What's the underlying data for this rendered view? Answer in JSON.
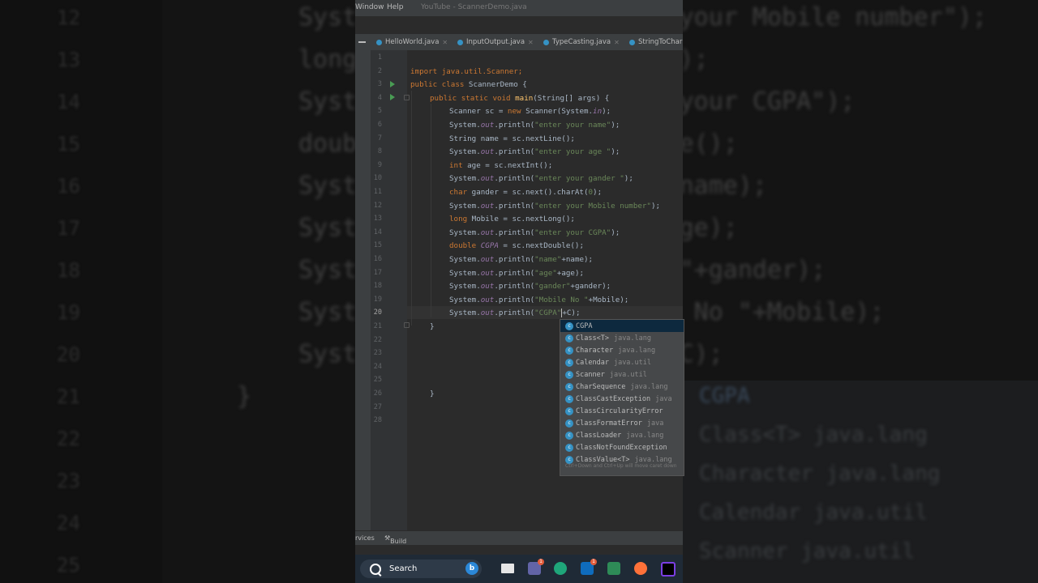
{
  "menu": {
    "window": "Window",
    "help": "Help",
    "title": "YouTube - ScannerDemo.java"
  },
  "tabs": [
    {
      "label": "HelloWorld.java"
    },
    {
      "label": "InputOutput.java"
    },
    {
      "label": "TypeCasting.java"
    },
    {
      "label": "StringToChar"
    }
  ],
  "line_numbers": [
    "1",
    "2",
    "3",
    "4",
    "5",
    "6",
    "7",
    "8",
    "9",
    "10",
    "11",
    "12",
    "13",
    "14",
    "15",
    "16",
    "17",
    "18",
    "19",
    "20",
    "21",
    "22",
    "23",
    "24",
    "25",
    "26",
    "27",
    "28"
  ],
  "active_line": "20",
  "code": {
    "l2": [
      "import java.util.Scanner;"
    ],
    "l3": [
      "public class",
      " ScannerDemo {"
    ],
    "l4": [
      "public static void",
      " ",
      "main",
      "(String[] args) {"
    ],
    "l5": [
      "Scanner sc = ",
      "new",
      " Scanner(System.",
      "in",
      ");"
    ],
    "l6": [
      "System.",
      "out",
      ".println(",
      "\"enter your name\"",
      ");"
    ],
    "l7": [
      "String name = sc.nextLine();"
    ],
    "l8": [
      "System.",
      "out",
      ".println(",
      "\"enter your age \"",
      ");"
    ],
    "l9": [
      "int",
      " age = sc.nextInt();"
    ],
    "l10": [
      "System.",
      "out",
      ".println(",
      "\"enter your gander \"",
      ");"
    ],
    "l11": [
      "char",
      " gander = sc.next().charAt(",
      "0",
      ");"
    ],
    "l12": [
      "System.",
      "out",
      ".println(",
      "\"enter your Mobile number\"",
      ");"
    ],
    "l13": [
      "long",
      " Mobile = sc.nextLong();"
    ],
    "l14": [
      "System.",
      "out",
      ".println(",
      "\"enter your CGPA\"",
      ");"
    ],
    "l15": [
      "double",
      " ",
      "CGPA",
      " = sc.nextDouble();"
    ],
    "l16": [
      "System.",
      "out",
      ".println(",
      "\"name\"",
      "+name);"
    ],
    "l17": [
      "System.",
      "out",
      ".println(",
      "\"age\"",
      "+age);"
    ],
    "l18": [
      "System.",
      "out",
      ".println(",
      "\"gander\"",
      "+gander);"
    ],
    "l19": [
      "System.",
      "out",
      ".println(",
      "\"Mobile No \"",
      "+Mobile);"
    ],
    "l20": [
      "System.",
      "out",
      ".println(",
      "\"CGPA\"",
      "+C",
      ");"
    ],
    "l21": [
      "}"
    ],
    "l26": [
      "}"
    ]
  },
  "autocomplete": {
    "items": [
      {
        "name": "CGPA",
        "pkg": ""
      },
      {
        "name": "Class<T>",
        "pkg": "java.lang"
      },
      {
        "name": "Character",
        "pkg": "java.lang"
      },
      {
        "name": "Calendar",
        "pkg": "java.util"
      },
      {
        "name": "Scanner",
        "pkg": "java.util"
      },
      {
        "name": "CharSequence",
        "pkg": "java.lang"
      },
      {
        "name": "ClassCastException",
        "pkg": "java"
      },
      {
        "name": "ClassCircularityError",
        "pkg": ""
      },
      {
        "name": "ClassFormatError",
        "pkg": "java"
      },
      {
        "name": "ClassLoader",
        "pkg": "java.lang"
      },
      {
        "name": "ClassNotFoundException",
        "pkg": ""
      },
      {
        "name": "ClassValue<T>",
        "pkg": "java.lang"
      }
    ],
    "hint": "Ctrl+Down and Ctrl+Up will move caret down"
  },
  "bottom": {
    "services": "rvices",
    "build": "Build"
  },
  "taskbar": {
    "search_label": "Search",
    "teams_badge": "1",
    "mail_badge": "1"
  },
  "background_code": {
    "lines": [
      "System.out.println(\"enter your Mobile number\");",
      "long Mobile = sc.nextLong();",
      "System.out.println(\"enter your CGPA\");",
      "double CGPA = sc.nextDouble();",
      "System.out.println(\"name\"+name);",
      "System.out.println(\"age\"+age);",
      "System.out.println(\"gander\"+gander);",
      "System.out.println(\"Mobile No \"+Mobile);",
      "System.out.println(\"CGPA\"+C);",
      "}"
    ],
    "numbers": [
      "12",
      "13",
      "14",
      "15",
      "16",
      "17",
      "18",
      "19",
      "20",
      "21",
      "22",
      "23",
      "24",
      "25"
    ],
    "popup_items": [
      "CGPA",
      "Class<T> java.lang",
      "Character java.lang",
      "Calendar java.util",
      "Scanner java.util"
    ]
  }
}
